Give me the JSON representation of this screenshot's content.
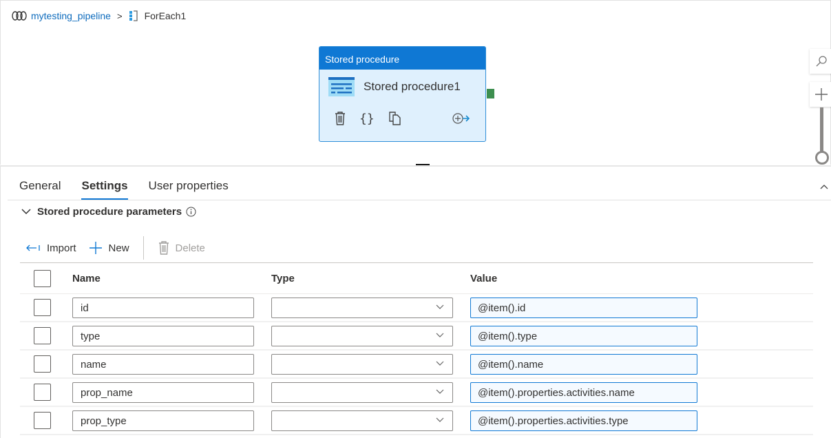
{
  "breadcrumb": {
    "pipeline": "mytesting_pipeline",
    "separator": ">",
    "current": "ForEach1"
  },
  "activity": {
    "type_label": "Stored procedure",
    "name": "Stored procedure1",
    "icons": [
      "delete-icon",
      "code-braces-icon",
      "copy-icon",
      "add-output-icon"
    ]
  },
  "canvas_tools": [
    "search-icon",
    "zoom-in-icon",
    "zoom-slider"
  ],
  "tabs": [
    {
      "label": "General",
      "active": false
    },
    {
      "label": "Settings",
      "active": true
    },
    {
      "label": "User properties",
      "active": false
    }
  ],
  "section": {
    "title": "Stored procedure parameters"
  },
  "toolbar": {
    "import_label": "Import",
    "new_label": "New",
    "delete_label": "Delete"
  },
  "table": {
    "headers": {
      "name": "Name",
      "type": "Type",
      "value": "Value"
    },
    "rows": [
      {
        "name": "id",
        "type": "",
        "value": "@item().id"
      },
      {
        "name": "type",
        "type": "",
        "value": "@item().type"
      },
      {
        "name": "name",
        "type": "",
        "value": "@item().name"
      },
      {
        "name": "prop_name",
        "type": "",
        "value": "@item().properties.activities.name"
      },
      {
        "name": "prop_type",
        "type": "",
        "value": "@item().properties.activities.type"
      }
    ]
  },
  "colors": {
    "accent": "#0f78d4",
    "link": "#0f6cbd",
    "activity_bg": "#dff0fd",
    "success_handle": "#3d8f4f"
  }
}
